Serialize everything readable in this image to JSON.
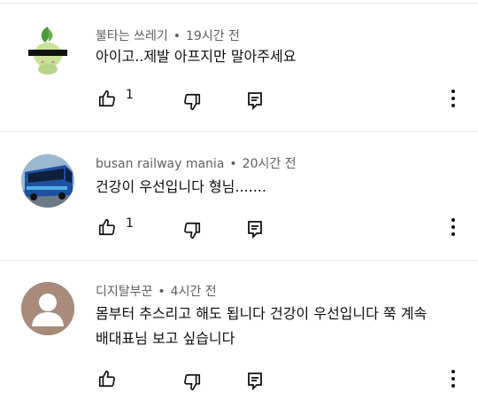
{
  "comments": [
    {
      "author": "불타는 쓰레기",
      "separator": "•",
      "time": "19시간 전",
      "text_lines": [
        "아이고..제발 아프지만 말아주세요"
      ],
      "like_count": "1",
      "avatar_icon": "green-pokemon-avatar"
    },
    {
      "author": "busan railway mania",
      "separator": "•",
      "time": "20시간 전",
      "text_lines": [
        "건강이 우선입니다 형님......."
      ],
      "like_count": "1",
      "avatar_icon": "blue-bus-avatar"
    },
    {
      "author": "디지탈부꾼",
      "separator": "•",
      "time": "4시간 전",
      "text_lines": [
        "몸부터 추스리고 해도 됩니다 건강이 우선입니다 쭉 계속",
        "배대표님 보고 싶습니다"
      ],
      "like_count": "",
      "avatar_icon": "default-user-avatar"
    }
  ],
  "icons": {
    "like": "thumbs-up-icon",
    "dislike": "thumbs-down-icon",
    "reply": "reply-comment-icon",
    "more": "more-vert-icon"
  }
}
